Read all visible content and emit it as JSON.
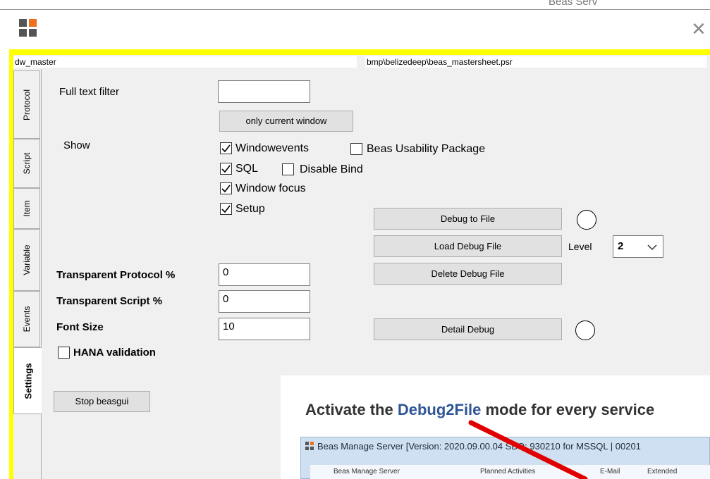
{
  "window": {
    "topright_text": "Beas Serv",
    "close_symbol": "✕"
  },
  "paths": {
    "left": "dw_master",
    "right": "bmp\\belizedeep\\beas_mastersheet.psr"
  },
  "tabs": [
    {
      "label": "Protocol"
    },
    {
      "label": "Script"
    },
    {
      "label": "Item"
    },
    {
      "label": "Variable"
    },
    {
      "label": "Events"
    },
    {
      "label": "Settings"
    }
  ],
  "settings": {
    "full_text_filter_label": "Full text filter",
    "full_text_filter_value": "",
    "only_current_window_button": "only current window",
    "show_label": "Show",
    "checks": {
      "windowevents": {
        "label": "Windowevents",
        "checked": true
      },
      "beas_usability": {
        "label": "Beas Usability Package",
        "checked": false
      },
      "sql": {
        "label": "SQL",
        "checked": true
      },
      "disable_bind": {
        "label": "Disable Bind",
        "checked": false
      },
      "window_focus": {
        "label": "Window focus",
        "checked": true
      },
      "setup": {
        "label": "Setup",
        "checked": true
      },
      "hana_validation": {
        "label": "HANA validation",
        "checked": false
      }
    },
    "debug_to_file_button": "Debug to File",
    "load_debug_file_button": "Load Debug File",
    "delete_debug_file_button": "Delete Debug File",
    "detail_debug_button": "Detail Debug",
    "level_label": "Level",
    "level_value": "2",
    "transparent_protocol_label": "Transparent Protocol %",
    "transparent_protocol_value": "0",
    "transparent_script_label": "Transparent Script %",
    "transparent_script_value": "0",
    "font_size_label": "Font Size",
    "font_size_value": "10",
    "stop_button": "Stop beasgui"
  },
  "overlay": {
    "title_prefix": "Activate the ",
    "title_highlight": "Debug2File",
    "title_suffix": " mode for every service",
    "screenshot_title": "Beas Manage Server [Version: 2020.09.00.04 SBO: 930210 for MSSQL | 00201",
    "screenshot_tabs": [
      "Beas Manage Server",
      "Planned Activities",
      "E-Mail",
      "Extended"
    ]
  },
  "colors": {
    "frame_highlight": "#ffff00",
    "panel_bg": "#f0f0f0",
    "title_accent": "#2f5597",
    "arrow": "#e00000"
  }
}
